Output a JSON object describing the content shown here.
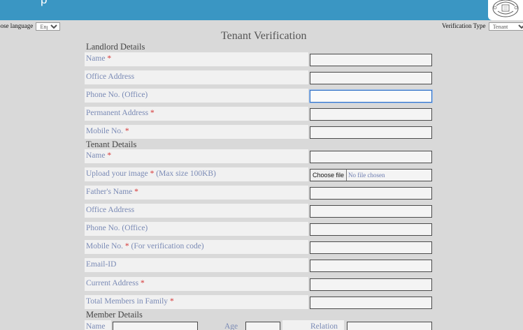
{
  "header": {
    "title_fragment": "p"
  },
  "language": {
    "label": "oose language",
    "selected": "English"
  },
  "verification_type": {
    "label": "Verification Type",
    "selected": "Tenant"
  },
  "page_title": "Tenant Verification",
  "landlord": {
    "section_title": "Landlord Details",
    "fields": [
      {
        "label": "Name",
        "required": "*",
        "note": ""
      },
      {
        "label": "Office Address",
        "required": "",
        "note": ""
      },
      {
        "label": "Phone No. (Office)",
        "required": "",
        "note": ""
      },
      {
        "label": "Permanent Address",
        "required": "*",
        "note": ""
      },
      {
        "label": "Mobile No.",
        "required": "*",
        "note": ""
      }
    ]
  },
  "tenant": {
    "section_title": "Tenant Details",
    "fields": [
      {
        "label": "Name",
        "required": "*",
        "note": ""
      },
      {
        "label": "Upload your image",
        "required": "*",
        "note": "(Max size 100KB)"
      },
      {
        "label": "Father's Name",
        "required": "*",
        "note": ""
      },
      {
        "label": "Office Address",
        "required": "",
        "note": ""
      },
      {
        "label": "Phone No. (Office)",
        "required": "",
        "note": ""
      },
      {
        "label": "Mobile No.",
        "required": "*",
        "note": "(For verification code)"
      },
      {
        "label": "Email-ID",
        "required": "",
        "note": ""
      },
      {
        "label": "Current Address",
        "required": "*",
        "note": ""
      },
      {
        "label": "Total Members in Family",
        "required": "*",
        "note": ""
      }
    ],
    "file_input": {
      "button": "Choose file",
      "status": "No file chosen"
    }
  },
  "members": {
    "section_title": "Member Details",
    "name_label": "Name",
    "age_label": "Age",
    "relation_label": "Relation"
  }
}
